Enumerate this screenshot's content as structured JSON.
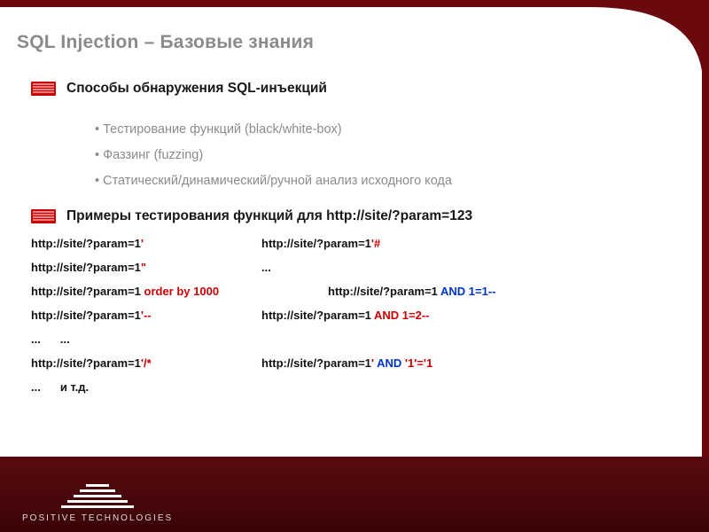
{
  "title": "SQL Injection – Базовые знания",
  "section1": {
    "heading": "Способы обнаружения SQL-инъекций",
    "bullets": [
      "Тестирование функций (black/white-box)",
      "Фаззинг (fuzzing)",
      "Статический/динамический/ручной анализ исходного кода"
    ]
  },
  "section2": {
    "heading": "Примеры тестирования функций для http://site/?param=123"
  },
  "examples": {
    "r1c1_base": "http://site/?param=1",
    "r1c1_inj": "'",
    "r1c2_base": "http://site/?param=1",
    "r1c2_inj": "'#",
    "r2c1_base": "http://site/?param=1",
    "r2c1_inj": "\"",
    "r2c2": "...",
    "r3c1_base": "http://site/?param=1",
    "r3c1_inj": " order by 1000",
    "r3c2_base": "http://site/?param=1",
    "r3c2_inj": " AND 1=1--",
    "r4c1_base": "http://site/?param=1",
    "r4c1_inj": "'--",
    "r4c2_base": "http://site/?param=1",
    "r4c2_inj": " AND 1=2--",
    "r5c1": "...",
    "r5c2": "...",
    "r6c1_base": "http://site/?param=1",
    "r6c1_inj": "'/*",
    "r6c2_base": "http://site/?param=1",
    "r6c2_inj_a": "'",
    "r6c2_inj_b": " AND ",
    "r6c2_inj_c": "'1'='1",
    "r7c1": "...",
    "r7c2": "и т.д."
  },
  "footer": {
    "brand": "POSITIVE  TECHNOLOGIES",
    "next_icon": "▶"
  }
}
